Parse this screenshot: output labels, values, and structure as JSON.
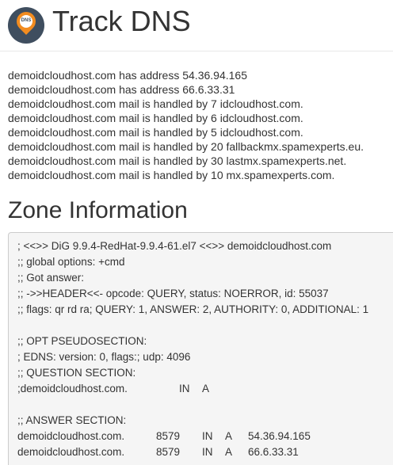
{
  "header": {
    "logo_label": "DNS",
    "title": "Track DNS"
  },
  "records": [
    "demoidcloudhost.com has address 54.36.94.165",
    "demoidcloudhost.com has address 66.6.33.31",
    "demoidcloudhost.com mail is handled by 7 idcloudhost.com.",
    "demoidcloudhost.com mail is handled by 6 idcloudhost.com.",
    "demoidcloudhost.com mail is handled by 5 idcloudhost.com.",
    "demoidcloudhost.com mail is handled by 20 fallbackmx.spamexperts.eu.",
    "demoidcloudhost.com mail is handled by 30 lastmx.spamexperts.net.",
    "demoidcloudhost.com mail is handled by 10 mx.spamexperts.com."
  ],
  "zone": {
    "title": "Zone Information",
    "lines": [
      "; <<>> DiG 9.9.4-RedHat-9.9.4-61.el7 <<>> demoidcloudhost.com",
      ";; global options: +cmd",
      ";; Got answer:",
      ";; ->>HEADER<<- opcode: QUERY, status: NOERROR, id: 55037",
      ";; flags: qr rd ra; QUERY: 1, ANSWER: 2, AUTHORITY: 0, ADDITIONAL: 1",
      "",
      ";; OPT PSEUDOSECTION:",
      "; EDNS: version: 0, flags:; udp: 4096",
      ";; QUESTION SECTION:"
    ],
    "question": {
      "name": ";demoidcloudhost.com.",
      "class": "IN",
      "type": "A"
    },
    "answer_header": ";; ANSWER SECTION:",
    "answers": [
      {
        "name": "demoidcloudhost.com.",
        "ttl": "8579",
        "class": "IN",
        "type": "A",
        "value": "54.36.94.165"
      },
      {
        "name": "demoidcloudhost.com.",
        "ttl": "8579",
        "class": "IN",
        "type": "A",
        "value": "66.6.33.31"
      }
    ]
  },
  "colors": {
    "logo_bg": "#3f4e5f",
    "pin": "#f28c20",
    "zone_bg": "#f5f5f5",
    "text": "#333333"
  }
}
